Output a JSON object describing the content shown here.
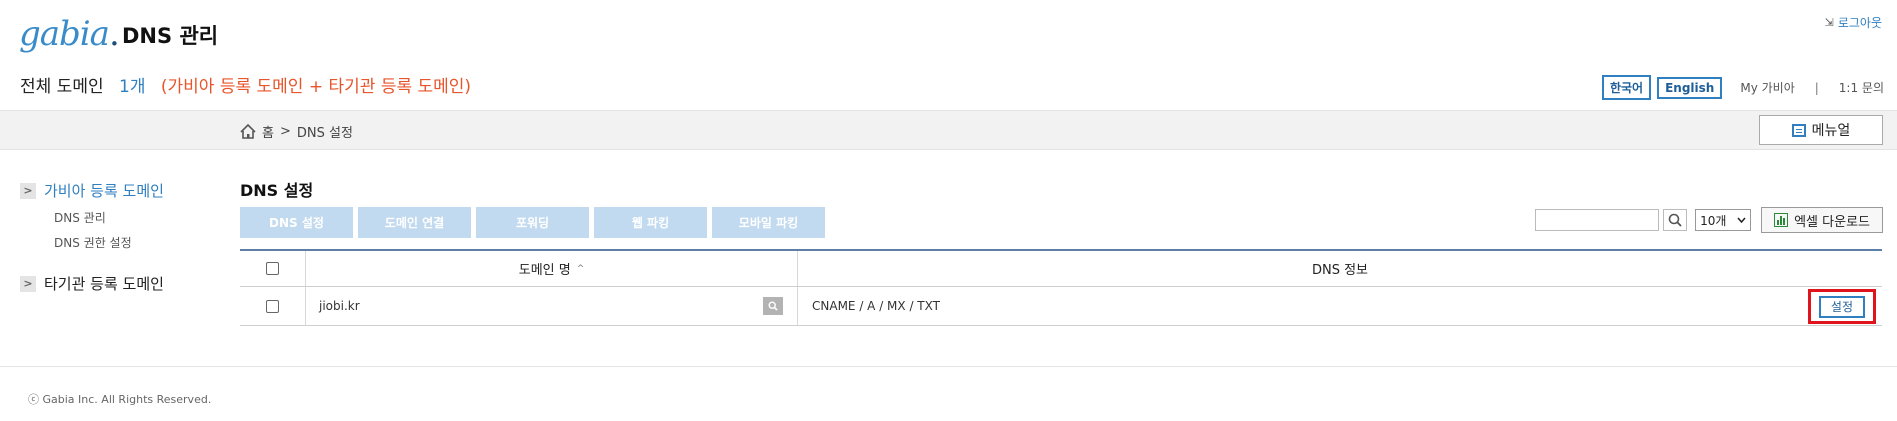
{
  "header": {
    "logo_text": "gabia",
    "logo_dot": ".",
    "title": "DNS 관리",
    "logout_label": "로그아웃"
  },
  "summary": {
    "label": "전체 도메인",
    "count": "1개",
    "detail": "(가비아 등록 도메인 + 타기관 등록 도메인)"
  },
  "top_links": {
    "lang_ko": "한국어",
    "lang_en": "English",
    "my_gabia": "My 가비아",
    "separator": "|",
    "inquiry": "1:1 문의"
  },
  "breadcrumb": {
    "home": "홈",
    "arrow": ">",
    "current": "DNS 설정"
  },
  "menu_button": "메뉴얼",
  "sidebar": {
    "groups": [
      {
        "label": "가비아 등록 도메인",
        "chevron": ">",
        "items": [
          "DNS 관리",
          "DNS 권한 설정"
        ]
      },
      {
        "label": "타기관 등록 도메인",
        "chevron": ">"
      }
    ]
  },
  "main": {
    "title": "DNS 설정",
    "tabs": [
      "DNS 설정",
      "도메인 연결",
      "포워딩",
      "웹 파킹",
      "모바일 파킹"
    ],
    "search_value": "",
    "per_page": "10개",
    "excel_label": "엑셀 다운로드"
  },
  "table": {
    "headers": {
      "domain": "도메인 명",
      "sort": "^",
      "dns": "DNS 정보"
    },
    "rows": [
      {
        "domain": "jiobi.kr",
        "dns": "CNAME / A / MX / TXT",
        "action": "설정"
      }
    ]
  },
  "footer": "ⓒ Gabia Inc. All Rights Reserved.",
  "colors": {
    "brand_blue": "#2f7fc1",
    "accent_orange": "#e8542b",
    "tab_disabled": "#c2daef",
    "highlight_red": "#e0141c"
  }
}
